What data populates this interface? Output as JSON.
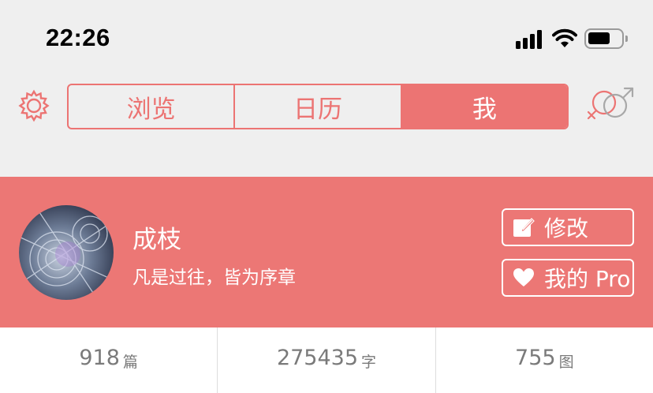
{
  "status_bar": {
    "time": "22:26",
    "icons": [
      "cellular-signal-icon",
      "wifi-icon",
      "battery-icon"
    ]
  },
  "nav": {
    "settings_icon": "gear-icon",
    "tabs": [
      {
        "label": "浏览",
        "active": false
      },
      {
        "label": "日历",
        "active": false
      },
      {
        "label": "我",
        "active": true
      }
    ],
    "gender_icon": "gender-icon"
  },
  "profile": {
    "username": "成枝",
    "bio": "凡是过往，皆为序章",
    "edit_label": "修改",
    "pro_label": "我的 Pro"
  },
  "stats": [
    {
      "value": "918",
      "unit": "篇"
    },
    {
      "value": "275435",
      "unit": "字"
    },
    {
      "value": "755",
      "unit": "图"
    }
  ],
  "colors": {
    "accent": "#ec7473",
    "background": "#efefef",
    "text_muted": "#7a7a7a"
  }
}
